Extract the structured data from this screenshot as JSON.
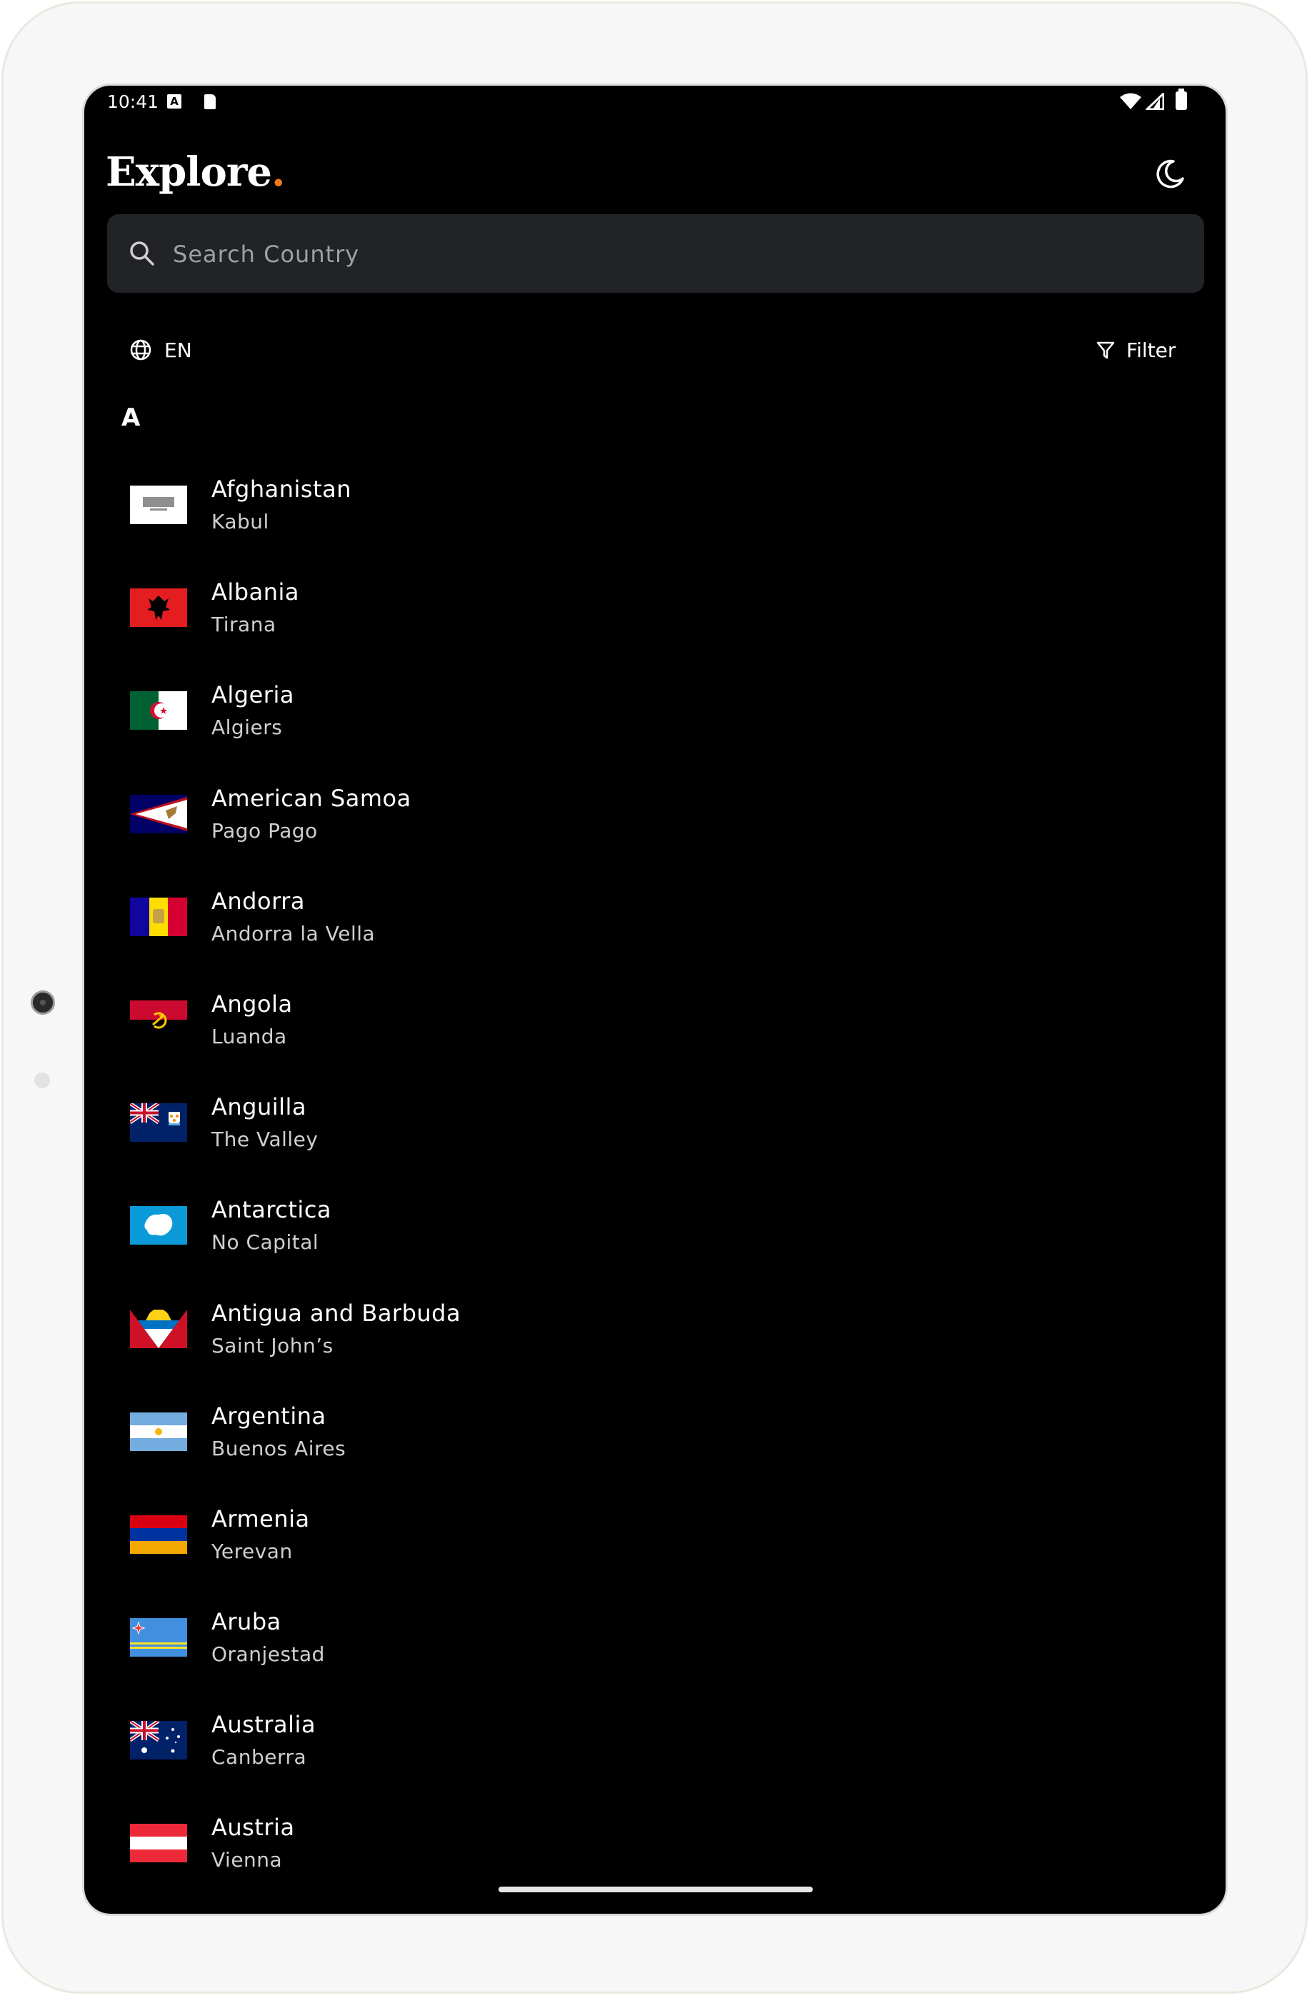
{
  "status_bar": {
    "time": "10:41",
    "icons": [
      "a-notification-icon",
      "sd-card-icon",
      "wifi-icon",
      "cell-signal-icon",
      "battery-icon"
    ]
  },
  "header": {
    "logo_text": "Explore",
    "logo_dot": ".",
    "logo_dot_color": "#f07a1c",
    "theme_toggle_icon": "moon-icon"
  },
  "search": {
    "placeholder": "Search Country",
    "value": ""
  },
  "language": {
    "label": "EN",
    "icon": "globe-icon"
  },
  "filter": {
    "label": "Filter",
    "icon": "funnel-icon"
  },
  "section_letter": "A",
  "countries": [
    {
      "name": "Afghanistan",
      "capital": "Kabul"
    },
    {
      "name": "Albania",
      "capital": "Tirana"
    },
    {
      "name": "Algeria",
      "capital": "Algiers"
    },
    {
      "name": "American Samoa",
      "capital": "Pago Pago"
    },
    {
      "name": "Andorra",
      "capital": "Andorra la Vella"
    },
    {
      "name": "Angola",
      "capital": "Luanda"
    },
    {
      "name": "Anguilla",
      "capital": "The Valley"
    },
    {
      "name": "Antarctica",
      "capital": "No Capital"
    },
    {
      "name": "Antigua and Barbuda",
      "capital": "Saint John’s"
    },
    {
      "name": "Argentina",
      "capital": "Buenos Aires"
    },
    {
      "name": "Armenia",
      "capital": "Yerevan"
    },
    {
      "name": "Aruba",
      "capital": "Oranjestad"
    },
    {
      "name": "Australia",
      "capital": "Canberra"
    },
    {
      "name": "Austria",
      "capital": "Vienna"
    }
  ],
  "colors": {
    "background": "#000000",
    "search_bg": "#222326",
    "accent": "#f07a1c"
  }
}
